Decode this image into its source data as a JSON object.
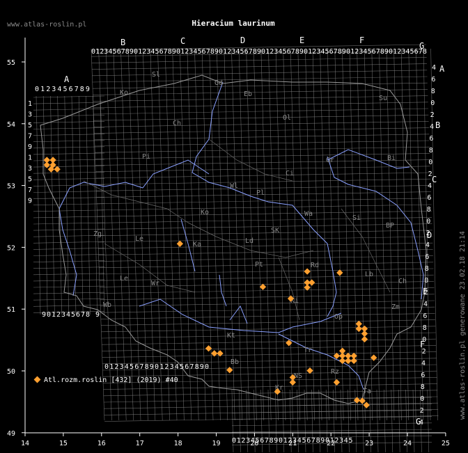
{
  "header": {
    "site": "www.atlas-roslin.pl",
    "title": "Hieracium laurinum"
  },
  "footer": {
    "generated": "www.atlas-roslin.pl generowane 23.02.18 21:14"
  },
  "legend": {
    "label": "Atl.rozm.roslin [432] (2019) #40",
    "marker_color": "#ffa030"
  },
  "colors": {
    "background": "#000000",
    "grid": "#8a8a8a",
    "text": "#ffffff",
    "muted_text": "#8a8a8a",
    "rivers": "#8aa0ff",
    "marker": "#ffa030"
  },
  "axes": {
    "x_ticks": [
      "14",
      "15",
      "16",
      "17",
      "18",
      "19",
      "20",
      "21",
      "22",
      "23",
      "24",
      "25"
    ],
    "y_ticks": [
      "55",
      "54",
      "53",
      "52",
      "51",
      "50",
      "49"
    ]
  },
  "grid_letters": {
    "columns_top": [
      "A",
      "B",
      "C",
      "D",
      "E",
      "F",
      "G"
    ],
    "rows_right": [
      "A",
      "B",
      "C",
      "D",
      "E",
      "F",
      "G"
    ]
  },
  "digit_rows": {
    "top_main": "0123456789012345678901234567890123456789012345678901234567890123456789012345678",
    "top_a": "0123456789",
    "left_a": "1357913579",
    "left_lower": "9012345678 9",
    "bottom_c": "012345678901234567890",
    "bottom_d": "01234567890123456789012345"
  },
  "region_labels": [
    {
      "code": "Sl"
    },
    {
      "code": "Gd"
    },
    {
      "code": "Eb"
    },
    {
      "code": "Su"
    },
    {
      "code": "Ko"
    },
    {
      "code": "Ch"
    },
    {
      "code": "Ol"
    },
    {
      "code": "Bi"
    },
    {
      "code": "Pi"
    },
    {
      "code": "Ci"
    },
    {
      "code": "Gr"
    },
    {
      "code": "Wl"
    },
    {
      "code": "Pl"
    },
    {
      "code": "Ko"
    },
    {
      "code": "Wa"
    },
    {
      "code": "Si"
    },
    {
      "code": "BP"
    },
    {
      "code": "Zg"
    },
    {
      "code": "Le"
    },
    {
      "code": "Ka"
    },
    {
      "code": "Ld"
    },
    {
      "code": "SK"
    },
    {
      "code": "Pt"
    },
    {
      "code": "Rd"
    },
    {
      "code": "Lb"
    },
    {
      "code": "Ch"
    },
    {
      "code": "Le"
    },
    {
      "code": "Wr"
    },
    {
      "code": "Ki"
    },
    {
      "code": "Zm"
    },
    {
      "code": "Wb"
    },
    {
      "code": "Op"
    },
    {
      "code": "Kt"
    },
    {
      "code": "Tr"
    },
    {
      "code": "Rz"
    },
    {
      "code": "Bb"
    },
    {
      "code": "NS"
    },
    {
      "code": "Kr"
    },
    {
      "code": "Ta"
    }
  ],
  "records": [
    {
      "lon": 14.57,
      "lat": 53.43
    },
    {
      "lon": 14.73,
      "lat": 53.43
    },
    {
      "lon": 14.57,
      "lat": 53.35
    },
    {
      "lon": 14.73,
      "lat": 53.35
    },
    {
      "lon": 14.68,
      "lat": 53.28
    },
    {
      "lon": 14.84,
      "lat": 53.28
    },
    {
      "lon": 18.05,
      "lat": 52.07
    },
    {
      "lon": 20.22,
      "lat": 51.37
    },
    {
      "lon": 20.95,
      "lat": 51.18
    },
    {
      "lon": 21.38,
      "lat": 51.62
    },
    {
      "lon": 21.38,
      "lat": 51.44
    },
    {
      "lon": 21.5,
      "lat": 51.44
    },
    {
      "lon": 21.38,
      "lat": 51.36
    },
    {
      "lon": 22.23,
      "lat": 51.6
    },
    {
      "lon": 22.73,
      "lat": 50.77
    },
    {
      "lon": 22.73,
      "lat": 50.69
    },
    {
      "lon": 22.88,
      "lat": 50.69
    },
    {
      "lon": 22.88,
      "lat": 50.61
    },
    {
      "lon": 22.88,
      "lat": 50.52
    },
    {
      "lon": 18.8,
      "lat": 50.37
    },
    {
      "lon": 18.95,
      "lat": 50.29
    },
    {
      "lon": 19.1,
      "lat": 50.29
    },
    {
      "lon": 20.9,
      "lat": 50.46
    },
    {
      "lon": 22.3,
      "lat": 50.33
    },
    {
      "lon": 22.15,
      "lat": 50.25
    },
    {
      "lon": 22.3,
      "lat": 50.25
    },
    {
      "lon": 22.45,
      "lat": 50.25
    },
    {
      "lon": 22.6,
      "lat": 50.25
    },
    {
      "lon": 22.3,
      "lat": 50.17
    },
    {
      "lon": 22.45,
      "lat": 50.17
    },
    {
      "lon": 22.6,
      "lat": 50.17
    },
    {
      "lon": 23.12,
      "lat": 50.22
    },
    {
      "lon": 19.35,
      "lat": 50.02
    },
    {
      "lon": 21.0,
      "lat": 49.9
    },
    {
      "lon": 21.0,
      "lat": 49.82
    },
    {
      "lon": 21.45,
      "lat": 50.01
    },
    {
      "lon": 22.15,
      "lat": 49.82
    },
    {
      "lon": 20.6,
      "lat": 49.67
    },
    {
      "lon": 22.68,
      "lat": 49.53
    },
    {
      "lon": 22.82,
      "lat": 49.52
    },
    {
      "lon": 22.93,
      "lat": 49.45
    }
  ]
}
